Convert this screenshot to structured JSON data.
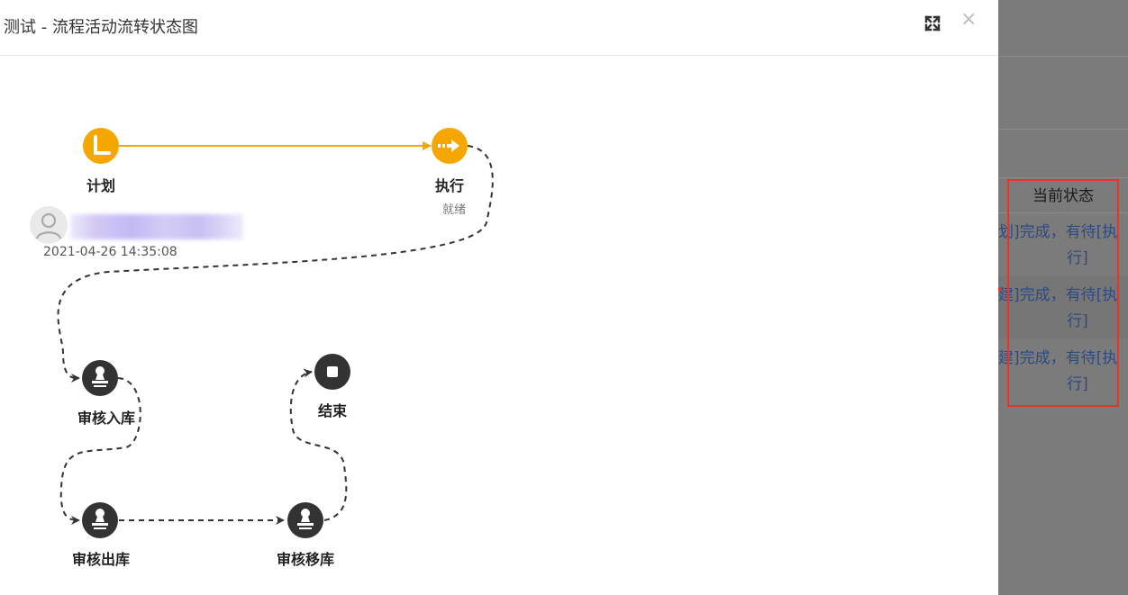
{
  "dialog": {
    "title": "测试 - 流程活动流转状态图",
    "maximize_icon": "expand-arrows-icon",
    "close_label": "×"
  },
  "flow": {
    "nodes": [
      {
        "id": "plan",
        "label": "计划",
        "icon": "clock-icon",
        "status": "done"
      },
      {
        "id": "execute",
        "label": "执行",
        "icon": "arrow-right-icon",
        "status": "current",
        "sub": "就绪"
      },
      {
        "id": "audit-in",
        "label": "审核入库",
        "icon": "stamp-icon",
        "status": "pending"
      },
      {
        "id": "audit-out",
        "label": "审核出库",
        "icon": "stamp-icon",
        "status": "pending"
      },
      {
        "id": "audit-move",
        "label": "审核移库",
        "icon": "stamp-icon",
        "status": "pending"
      },
      {
        "id": "end",
        "label": "结束",
        "icon": "stop-icon",
        "status": "pending"
      }
    ],
    "plan_record": {
      "user_icon": "user-avatar-icon",
      "time": "2021-04-26 14:35:08"
    }
  },
  "background": {
    "column_header": "当前状态",
    "rows": [
      {
        "line1": "划]完成，有待[执",
        "line2": "行]"
      },
      {
        "line1": "建]完成，有待[执",
        "line2": "行]"
      },
      {
        "line1": "建]完成，有待[执",
        "line2": "行]"
      }
    ]
  },
  "colors": {
    "active": "#f5a600",
    "pending": "#333333",
    "annotation": "#e8322e",
    "link_text": "#2e4a82"
  }
}
